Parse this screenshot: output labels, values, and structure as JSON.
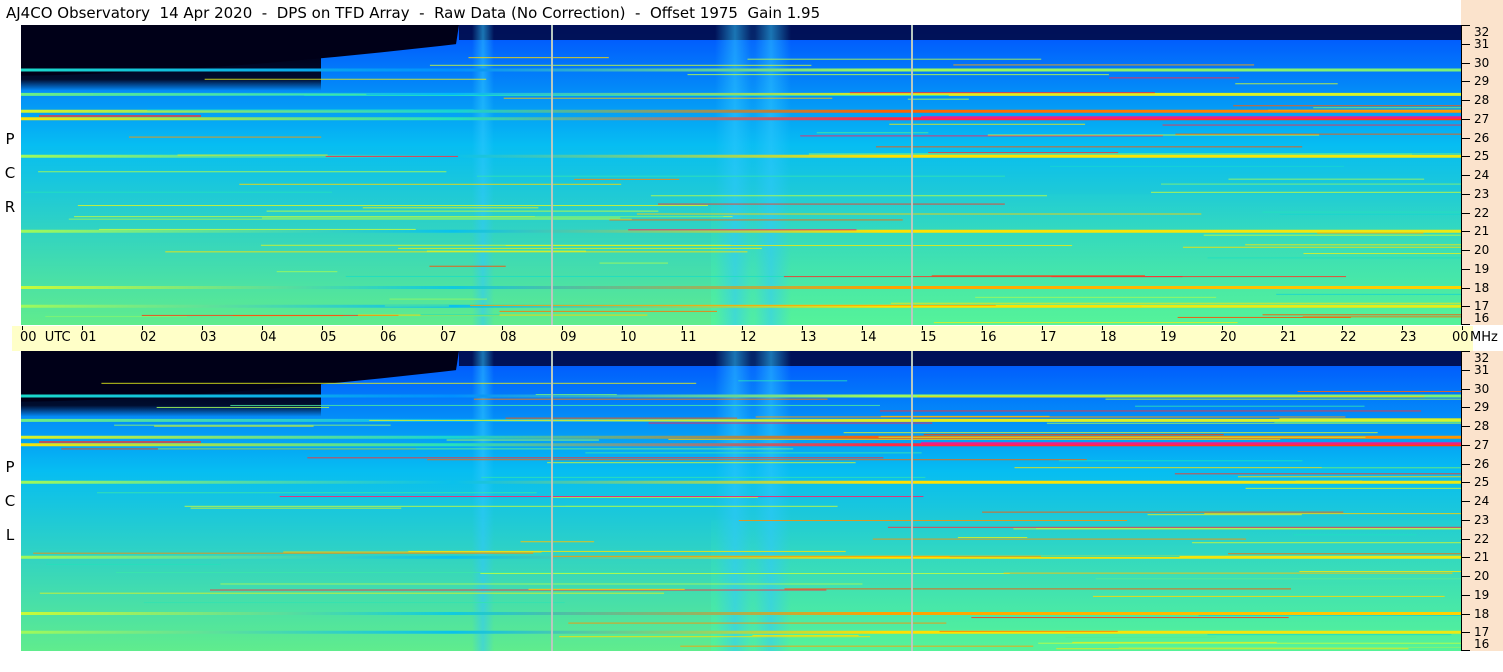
{
  "title": "AJ4CO Observatory  14 Apr 2020  -  DPS on TFD Array  -  Raw Data (No Correction)  -  Offset 1975  Gain 1.95",
  "polarizations": {
    "rcp": [
      "R",
      "C",
      "P"
    ],
    "lcp": [
      "L",
      "C",
      "P"
    ]
  },
  "time_axis": {
    "labels": [
      "00  UTC",
      "01",
      "02",
      "03",
      "04",
      "05",
      "06",
      "07",
      "08",
      "09",
      "10",
      "11",
      "12",
      "13",
      "14",
      "15",
      "16",
      "17",
      "18",
      "19",
      "20",
      "21",
      "22",
      "23",
      "00"
    ],
    "unit": "MHz"
  },
  "freq_axis": {
    "labels": [
      "32",
      "31",
      "30",
      "29",
      "28",
      "27",
      "26",
      "25",
      "24",
      "23",
      "22",
      "21",
      "20",
      "19",
      "18",
      "17",
      "16"
    ]
  },
  "chart_data": {
    "type": "heatmap",
    "title": "AJ4CO Observatory  14 Apr 2020  -  DPS on TFD Array  -  Raw Data (No Correction)  -  Offset 1975  Gain 1.95",
    "x_unit": "UTC hour",
    "xlim": [
      0,
      24
    ],
    "y_unit": "MHz",
    "ylim": [
      16,
      32
    ],
    "panels": [
      "RCP",
      "LCP"
    ],
    "colormap": [
      "#000020",
      "#0000a0",
      "#0050ff",
      "#00b4ff",
      "#20e0c0",
      "#c0ff40",
      "#ffe000",
      "#ff4000",
      "#ff00c0"
    ],
    "night_region_hours": [
      0,
      7.3
    ],
    "background_level": 0.42,
    "vertical_markers_hours": [
      8.85,
      14.85
    ],
    "bright_vertical_bands_hours": [
      7.7,
      11.9,
      12.5
    ],
    "horizontal_bands_mhz": [
      {
        "mhz": 27.0,
        "level": 0.92
      },
      {
        "mhz": 27.4,
        "level": 0.85
      },
      {
        "mhz": 28.3,
        "level": 0.7
      },
      {
        "mhz": 25.0,
        "level": 0.75
      },
      {
        "mhz": 21.0,
        "level": 0.75
      },
      {
        "mhz": 18.0,
        "level": 0.8
      },
      {
        "mhz": 17.0,
        "level": 0.75
      },
      {
        "mhz": 29.6,
        "level": 0.6
      }
    ]
  }
}
